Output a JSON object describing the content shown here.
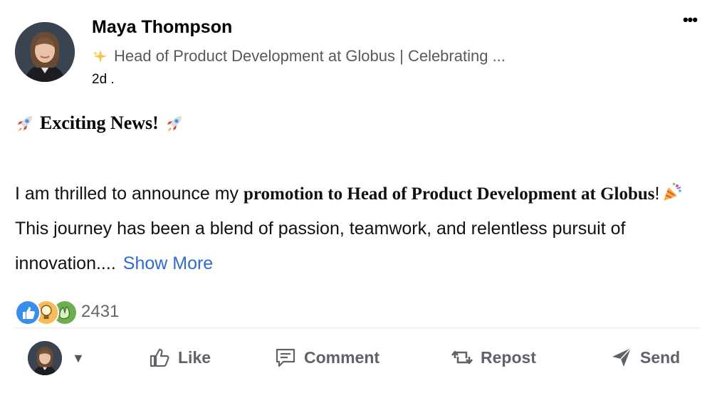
{
  "post": {
    "author": {
      "name": "Maya Thompson",
      "headline": "Head of Product Development at Globus | Celebrating ...",
      "headline_icon": "sparkle-icon",
      "time": "2d ."
    },
    "menu_label": "•••",
    "title": "Exciting News!",
    "title_icon": "rocket-icon",
    "body": {
      "lead": "I am thrilled to announce my ",
      "bold": "promotion to Head of Product Development at Globus",
      "after_bold": "!",
      "emoji": "party-popper-icon",
      "rest": " This journey has been a blend of passion, teamwork, and relentless pursuit of innovation....",
      "show_more": "Show More"
    },
    "reactions": {
      "icons": [
        "like-reaction-icon",
        "insightful-reaction-icon",
        "celebrate-reaction-icon"
      ],
      "count": "2431"
    }
  },
  "actions": {
    "actor_caret": "▼",
    "like": "Like",
    "comment": "Comment",
    "repost": "Repost",
    "send": "Send"
  },
  "colors": {
    "link": "#2f6bd1",
    "action_text": "#5f6368",
    "like_blue": "#378fe9",
    "insightful_gold": "#f5bb5c",
    "celebrate_green": "#6dae4f"
  }
}
